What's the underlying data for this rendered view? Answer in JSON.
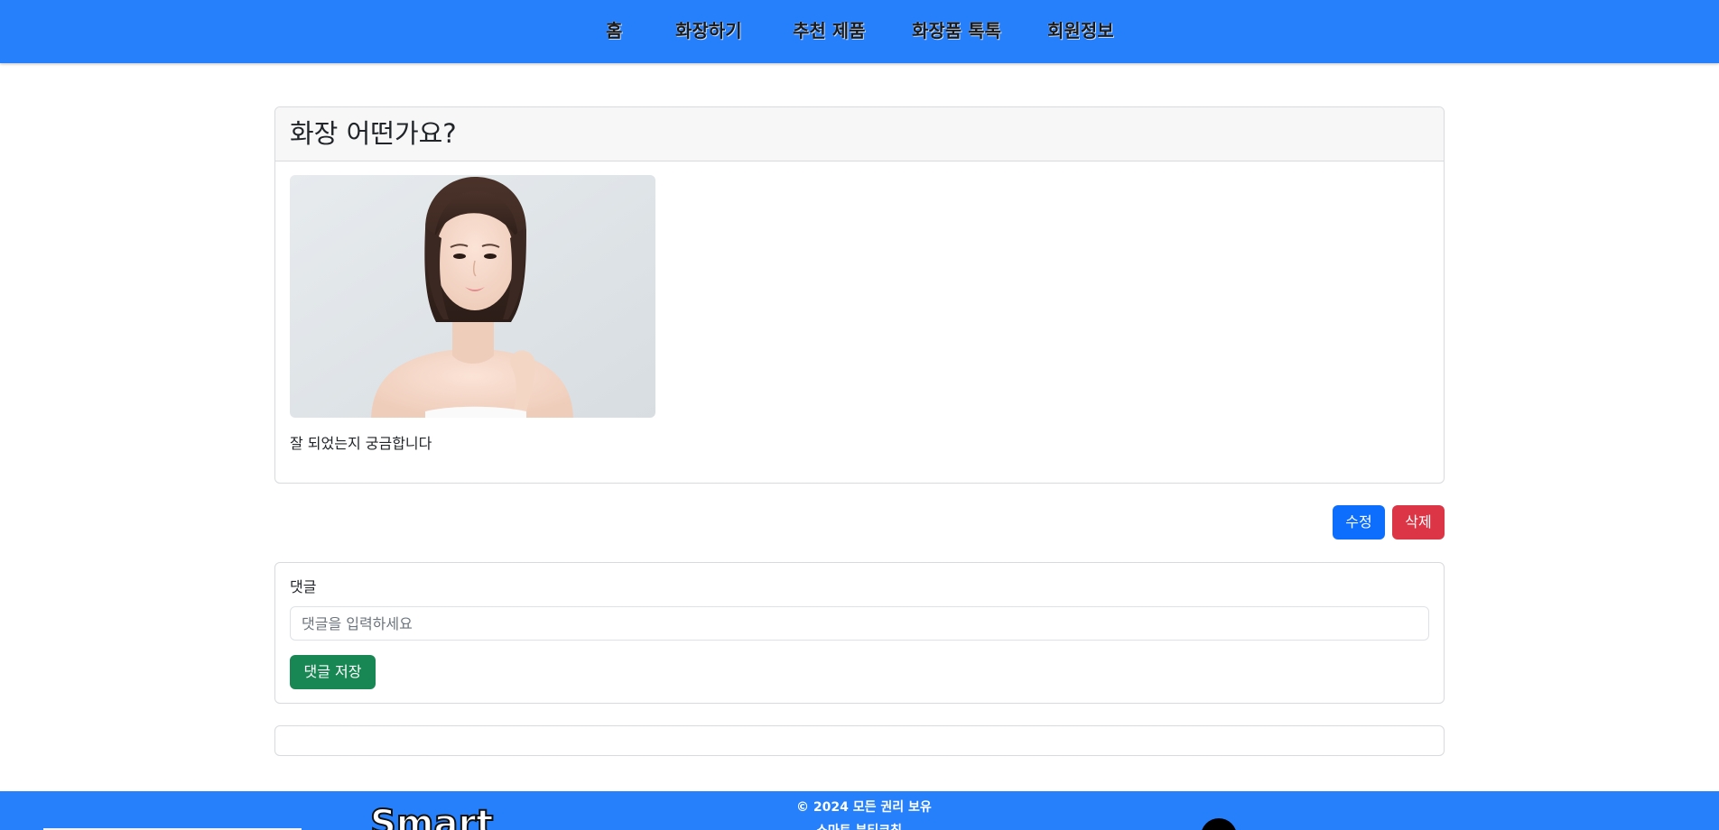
{
  "nav": {
    "items": [
      {
        "label": "홈"
      },
      {
        "label": "화장하기"
      },
      {
        "label": "추천 제품"
      },
      {
        "label": "화장품 톡톡"
      },
      {
        "label": "회원정보"
      }
    ]
  },
  "post": {
    "title": "화장 어떤가요?",
    "photo_alt": "short-bob-hair woman portrait",
    "body": "잘 되었는지 궁금합니다"
  },
  "actions": {
    "edit_label": "수정",
    "delete_label": "삭제"
  },
  "comment_form": {
    "label": "댓글",
    "placeholder": "댓글을 입력하세요",
    "value": "",
    "save_label": "댓글 저장"
  },
  "footer": {
    "logo": "Smart",
    "copyright": "© 2024 모든 권리 보유",
    "sub_text": "스마트 뷰티코칭"
  },
  "colors": {
    "brand_blue": "#2680fc",
    "primary": "#0d6efd",
    "danger": "#dc3545",
    "success": "#198754"
  },
  "icons": {
    "footer_social": "social-icon"
  }
}
